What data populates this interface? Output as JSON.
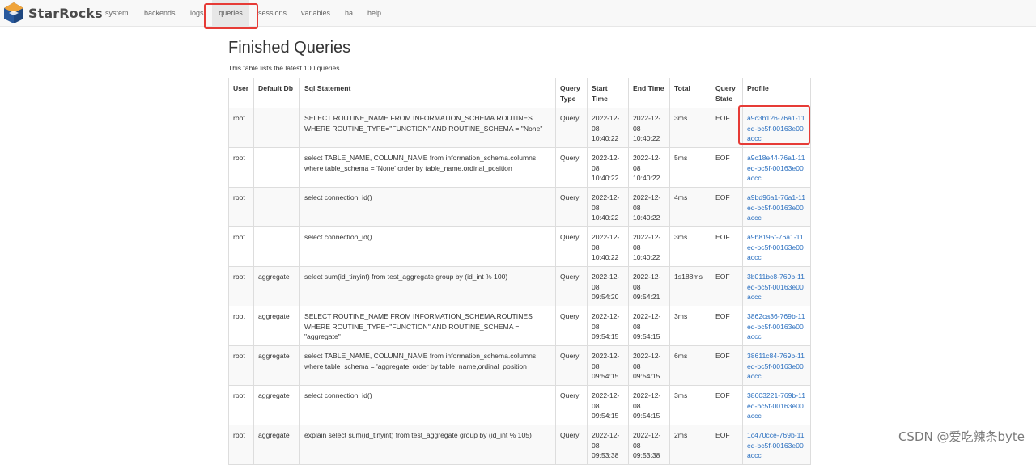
{
  "brand": {
    "name": "StarRocks"
  },
  "nav": [
    "system",
    "backends",
    "logs",
    "queries",
    "sessions",
    "variables",
    "ha",
    "help"
  ],
  "page": {
    "title": "Finished Queries",
    "subtitle": "This table lists the latest 100 queries"
  },
  "table": {
    "headers": [
      "User",
      "Default Db",
      "Sql Statement",
      "Query Type",
      "Start Time",
      "End Time",
      "Total",
      "Query State",
      "Profile"
    ],
    "rows": [
      [
        "root",
        "",
        "SELECT ROUTINE_NAME FROM INFORMATION_SCHEMA.ROUTINES WHERE ROUTINE_TYPE=\"FUNCTION\" AND ROUTINE_SCHEMA = \"None\"",
        "Query",
        "2022-12-08 10:40:22",
        "2022-12-08 10:40:22",
        "3ms",
        "EOF",
        "a9c3b126-76a1-11ed-bc5f-00163e00accc"
      ],
      [
        "root",
        "",
        "select TABLE_NAME, COLUMN_NAME from information_schema.columns where table_schema = 'None' order by table_name,ordinal_position",
        "Query",
        "2022-12-08 10:40:22",
        "2022-12-08 10:40:22",
        "5ms",
        "EOF",
        "a9c18e44-76a1-11ed-bc5f-00163e00accc"
      ],
      [
        "root",
        "",
        "select connection_id()",
        "Query",
        "2022-12-08 10:40:22",
        "2022-12-08 10:40:22",
        "4ms",
        "EOF",
        "a9bd96a1-76a1-11ed-bc5f-00163e00accc"
      ],
      [
        "root",
        "",
        "select connection_id()",
        "Query",
        "2022-12-08 10:40:22",
        "2022-12-08 10:40:22",
        "3ms",
        "EOF",
        "a9b8195f-76a1-11ed-bc5f-00163e00accc"
      ],
      [
        "root",
        "aggregate",
        "select sum(id_tinyint) from test_aggregate group by (id_int % 100)",
        "Query",
        "2022-12-08 09:54:20",
        "2022-12-08 09:54:21",
        "1s188ms",
        "EOF",
        "3b011bc8-769b-11ed-bc5f-00163e00accc"
      ],
      [
        "root",
        "aggregate",
        "SELECT ROUTINE_NAME FROM INFORMATION_SCHEMA.ROUTINES WHERE ROUTINE_TYPE=\"FUNCTION\" AND ROUTINE_SCHEMA = \"aggregate\"",
        "Query",
        "2022-12-08 09:54:15",
        "2022-12-08 09:54:15",
        "3ms",
        "EOF",
        "3862ca36-769b-11ed-bc5f-00163e00accc"
      ],
      [
        "root",
        "aggregate",
        "select TABLE_NAME, COLUMN_NAME from information_schema.columns where table_schema = 'aggregate' order by table_name,ordinal_position",
        "Query",
        "2022-12-08 09:54:15",
        "2022-12-08 09:54:15",
        "6ms",
        "EOF",
        "38611c84-769b-11ed-bc5f-00163e00accc"
      ],
      [
        "root",
        "aggregate",
        "select connection_id()",
        "Query",
        "2022-12-08 09:54:15",
        "2022-12-08 09:54:15",
        "3ms",
        "EOF",
        "38603221-769b-11ed-bc5f-00163e00accc"
      ],
      [
        "root",
        "aggregate",
        "explain select sum(id_tinyint) from test_aggregate group by (id_int % 105)",
        "Query",
        "2022-12-08 09:53:38",
        "2022-12-08 09:53:38",
        "2ms",
        "EOF",
        "1c470cce-769b-11ed-bc5f-00163e00accc"
      ]
    ]
  },
  "watermark": "CSDN @爱吃辣条byte",
  "colors": {
    "highlight": "#e63b36",
    "link": "#2a6fbf",
    "navbar": "#f8f8f8"
  }
}
